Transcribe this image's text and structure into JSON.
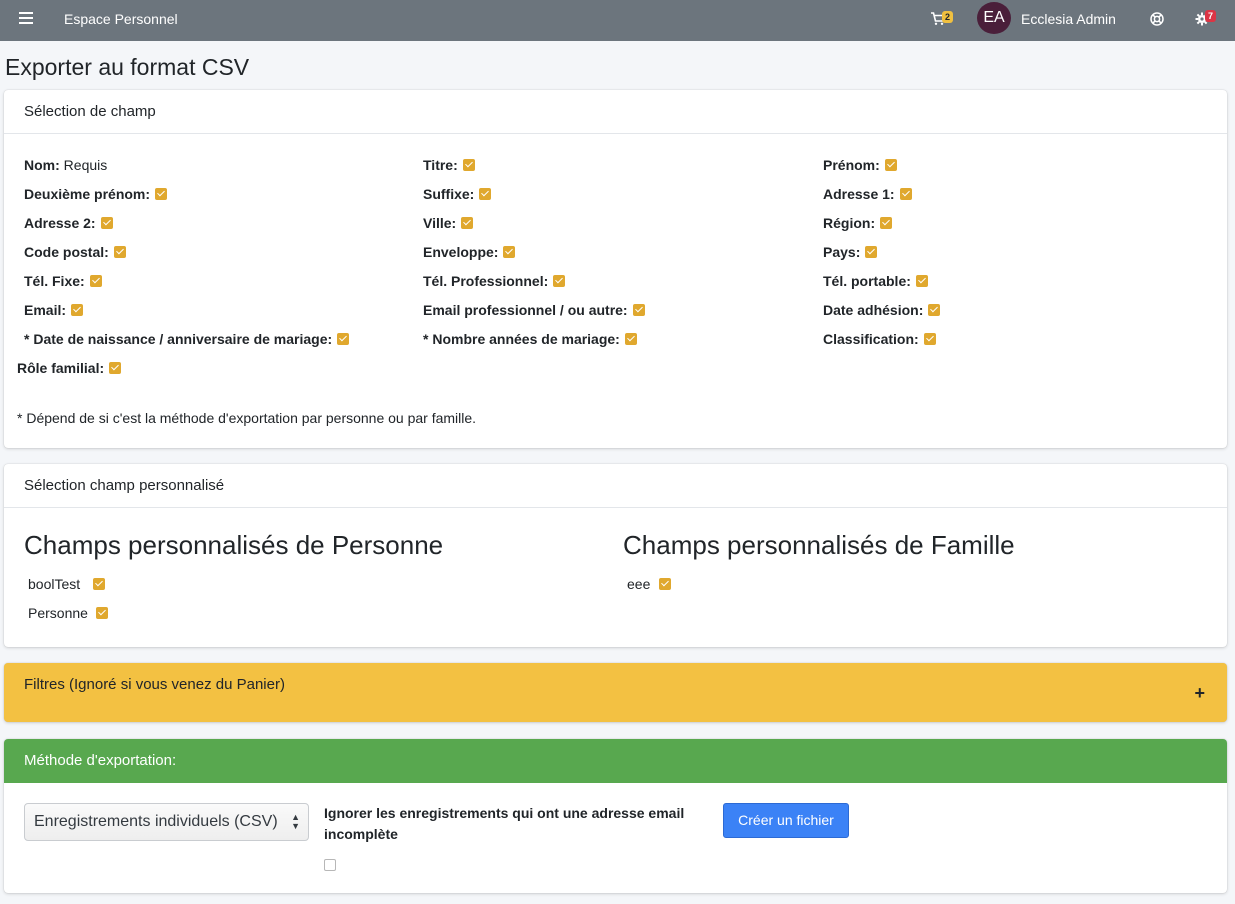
{
  "topbar": {
    "brand": "Espace Personnel",
    "cart_count": "2",
    "avatar_initials": "EA",
    "user_name": "Ecclesia Admin",
    "settings_count": "7"
  },
  "page_title": "Exporter au format CSV",
  "field_selection": {
    "header": "Sélection de champ",
    "fields": [
      {
        "label": "Nom:",
        "value": "Requis"
      },
      {
        "label": "Titre:"
      },
      {
        "label": "Prénom:"
      },
      {
        "label": "Deuxième prénom:"
      },
      {
        "label": "Suffixe:"
      },
      {
        "label": "Adresse 1:"
      },
      {
        "label": "Adresse 2:"
      },
      {
        "label": "Ville:"
      },
      {
        "label": "Région:"
      },
      {
        "label": "Code postal:"
      },
      {
        "label": "Enveloppe:"
      },
      {
        "label": "Pays:"
      },
      {
        "label": "Tél. Fixe:"
      },
      {
        "label": "Tél. Professionnel:"
      },
      {
        "label": "Tél. portable:"
      },
      {
        "label": "Email:"
      },
      {
        "label": "Email professionnel / ou autre:"
      },
      {
        "label": "Date adhésion:"
      },
      {
        "label": "* Date de naissance / anniversaire de mariage:"
      },
      {
        "label": "* Nombre années de mariage:"
      },
      {
        "label": "Classification:"
      },
      {
        "label": "Rôle familial:"
      }
    ],
    "note": "* Dépend de si c'est la méthode d'exportation par personne ou par famille."
  },
  "custom_selection": {
    "header": "Sélection champ personnalisé",
    "person_title": "Champs personnalisés de Personne",
    "person_fields": [
      "boolTest",
      "Personne"
    ],
    "family_title": "Champs personnalisés de Famille",
    "family_fields": [
      "eee"
    ]
  },
  "filters": {
    "header": "Filtres (Ignoré si vous venez du Panier)",
    "toggle": "+"
  },
  "export_method": {
    "header": "Méthode d'exportation:",
    "select_value": "Enregistrements individuels (CSV)",
    "ignore_label": "Ignorer les enregistrements qui ont une adresse email incomplète",
    "button": "Créer un fichier"
  },
  "colors": {
    "topbar": "#6c757d",
    "checkbox": "#e0a82e",
    "warning": "#f3c142",
    "success": "#58a84f",
    "primary": "#3b82f6"
  }
}
